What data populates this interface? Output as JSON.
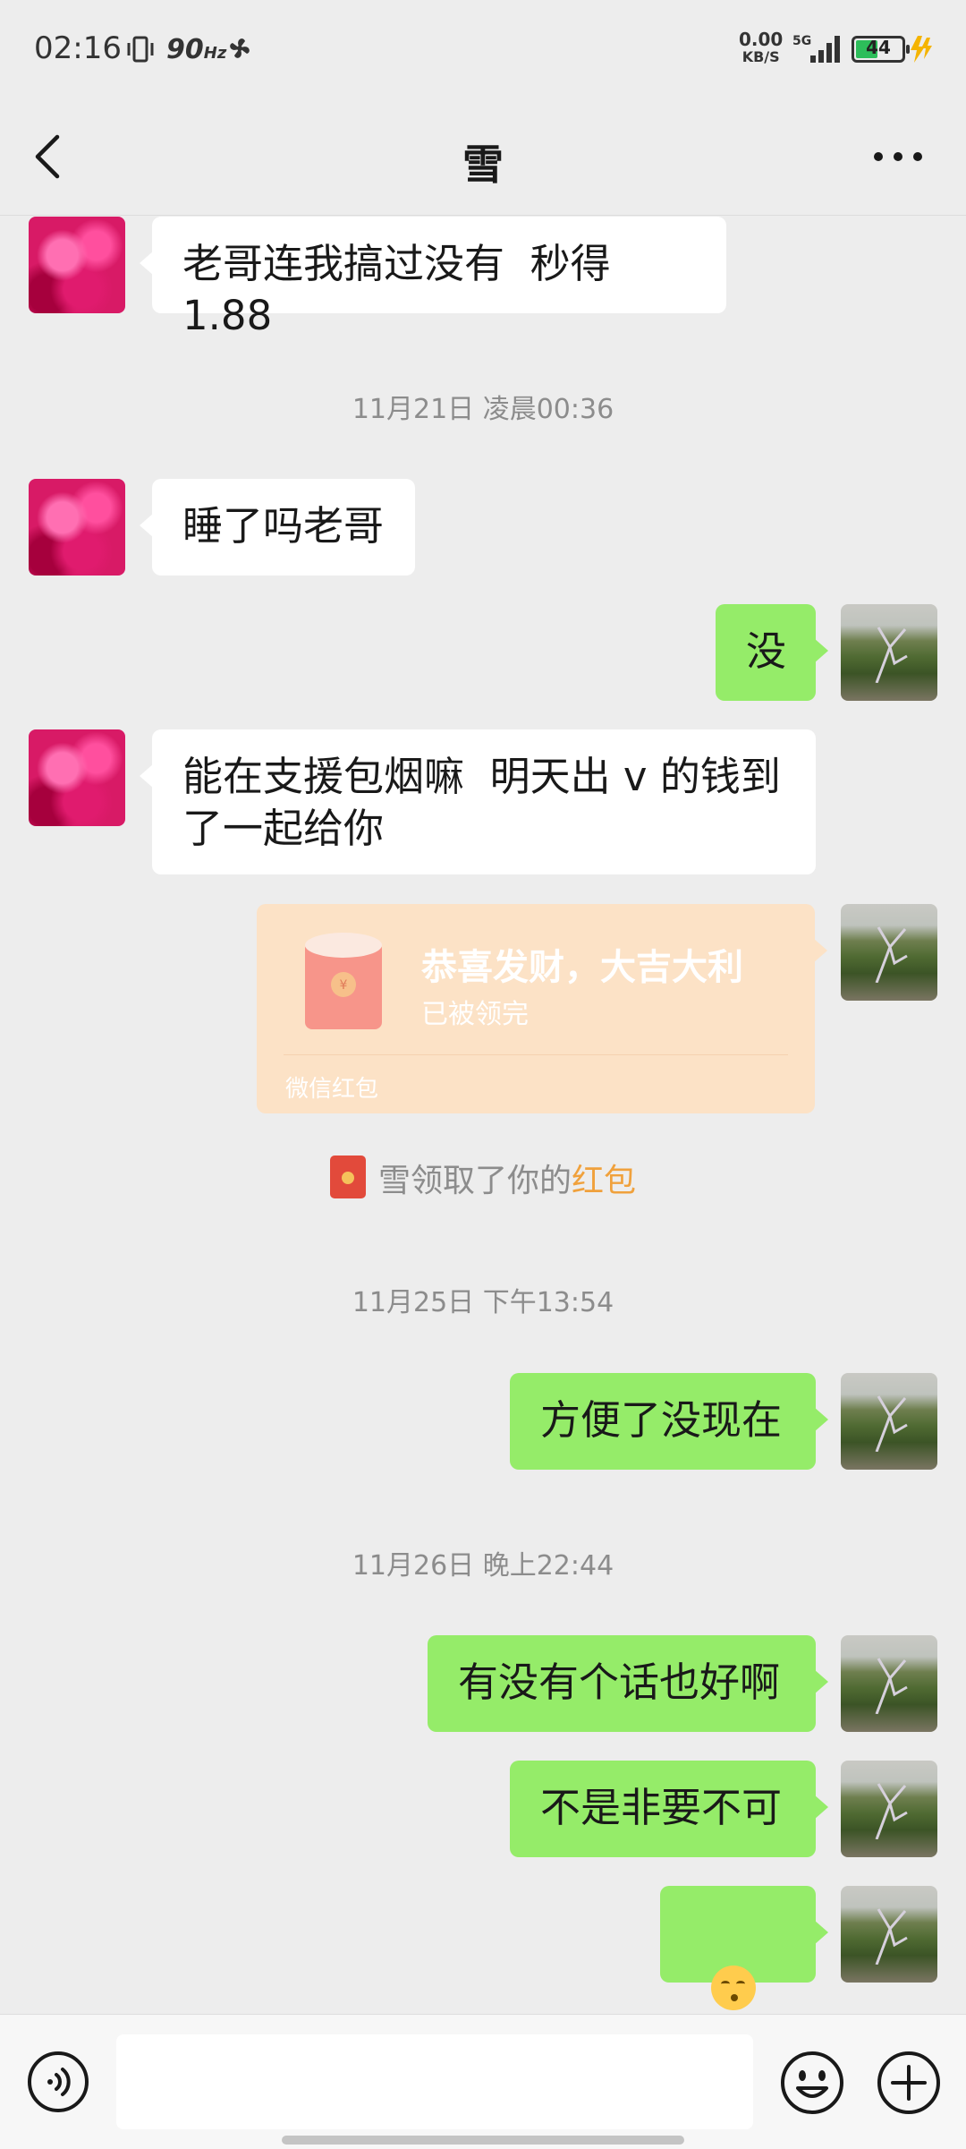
{
  "status": {
    "time": "02:16",
    "refresh": "90",
    "refresh_unit": "Hz",
    "net_speed_value": "0.00",
    "net_speed_unit": "KB/S",
    "network": "5G",
    "battery": "44"
  },
  "nav": {
    "title": "雪"
  },
  "messages": [
    {
      "from": "her",
      "text": "老哥连我搞过没有  秒得 1.88"
    },
    {
      "timestamp": "11月21日 凌晨00:36"
    },
    {
      "from": "her",
      "text": "睡了吗老哥"
    },
    {
      "from": "me",
      "text": "没"
    },
    {
      "from": "her",
      "text": "能在支援包烟嘛  明天出 v 的钱到\n了一起给你"
    },
    {
      "timestamp": "11月25日 下午13:54"
    },
    {
      "from": "me",
      "text": "方便了没现在"
    },
    {
      "timestamp": "11月26日 晚上22:44"
    },
    {
      "from": "me",
      "text": "有没有个话也好啊"
    },
    {
      "from": "me",
      "text": "不是非要不可"
    }
  ],
  "red_packet": {
    "title": "恭喜发财，大吉大利",
    "status": "已被领完",
    "label": "微信红包"
  },
  "system_note": {
    "prefix": "雪领取了你的",
    "highlight": "红包"
  },
  "emoji_message": [
    "face-with-closed-eyes-kissing",
    "face-with-closed-eyes-kissing"
  ],
  "colors": {
    "background": "#ededed",
    "bubble_in": "#ffffff",
    "bubble_out": "#95ec69",
    "red_packet": "#fce2c6",
    "highlight": "#f0a13c"
  }
}
